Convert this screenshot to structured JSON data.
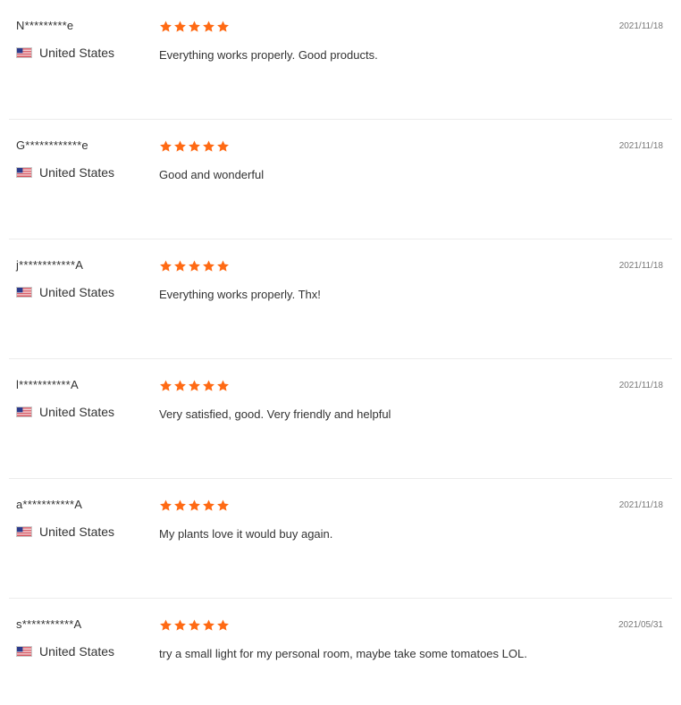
{
  "theme": {
    "star_color": "#ff6a14",
    "divider_color": "#ececec",
    "text_color": "#333333",
    "date_color": "#777777"
  },
  "reviews": [
    {
      "user": "N*********e",
      "country": "United States",
      "flag_icon": "us-flag-icon",
      "rating": 5,
      "date": "2021/11/18",
      "text": "Everything works properly. Good products."
    },
    {
      "user": "G************e",
      "country": "United States",
      "flag_icon": "us-flag-icon",
      "rating": 5,
      "date": "2021/11/18",
      "text": "Good and wonderful"
    },
    {
      "user": "j************A",
      "country": "United States",
      "flag_icon": "us-flag-icon",
      "rating": 5,
      "date": "2021/11/18",
      "text": "Everything works properly. Thx!"
    },
    {
      "user": "l***********A",
      "country": "United States",
      "flag_icon": "us-flag-icon",
      "rating": 5,
      "date": "2021/11/18",
      "text": "Very satisfied, good. Very friendly and helpful"
    },
    {
      "user": "a***********A",
      "country": "United States",
      "flag_icon": "us-flag-icon",
      "rating": 5,
      "date": "2021/11/18",
      "text": "My plants love it would buy again."
    },
    {
      "user": "s***********A",
      "country": "United States",
      "flag_icon": "us-flag-icon",
      "rating": 5,
      "date": "2021/05/31",
      "text": "try a small light for my personal room, maybe take some tomatoes LOL."
    }
  ]
}
